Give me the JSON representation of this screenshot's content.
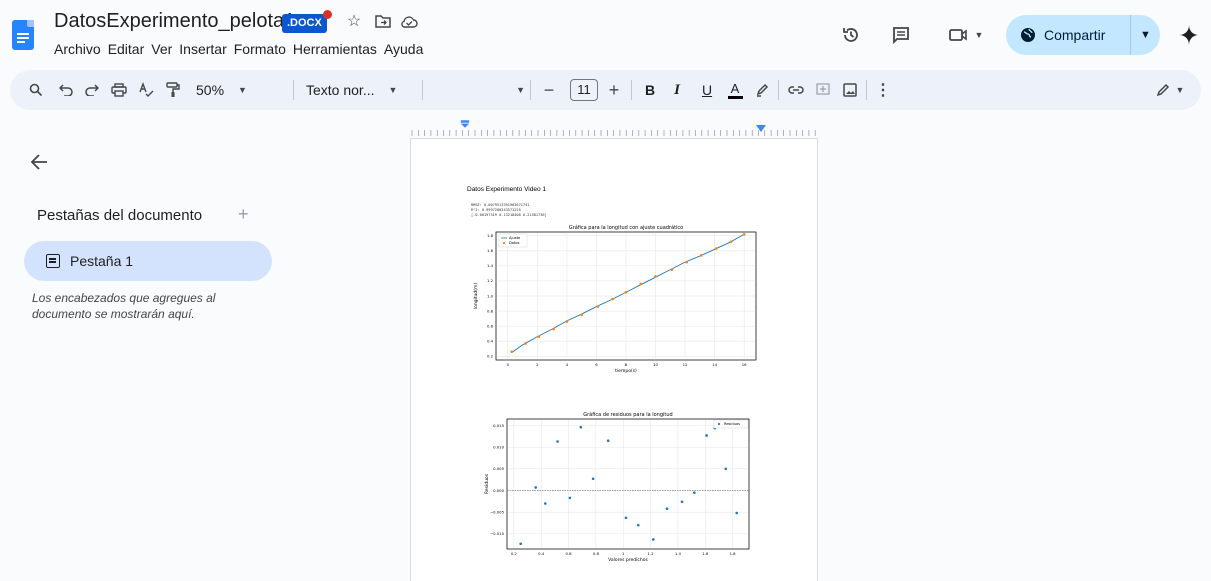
{
  "document": {
    "title": "DatosExperimento_pelota1",
    "format_badge": ".DOCX",
    "menu": [
      "Archivo",
      "Editar",
      "Ver",
      "Insertar",
      "Formato",
      "Herramientas",
      "Ayuda"
    ]
  },
  "header_actions": {
    "share_label": "Compartir"
  },
  "toolbar": {
    "zoom": "50%",
    "style": "Texto nor...",
    "font_size": "11",
    "bold": "B",
    "italic": "I",
    "underline": "U",
    "text_color": "A"
  },
  "sidebar": {
    "heading": "Pestañas del documento",
    "add": "+",
    "tabs": [
      {
        "label": "Pestaña 1"
      }
    ],
    "hint": "Los encabezados que agregues al documento se mostrarán aquí."
  },
  "page": {
    "title": "Datos Experimento Video 1",
    "stats": [
      "RMSE: 0.0079513391983671741",
      "R^2: 0.9997280343571225",
      "[-0.00197319  0.13218408  0.21581736]"
    ]
  },
  "colors": {
    "accent": "#0b57d0",
    "share_bg": "#c2e7ff",
    "active_tab": "#d3e3fd",
    "fit_line": "#1f77b4",
    "data_points": "#ff7f0e"
  },
  "chart_data": [
    {
      "type": "line",
      "title": "Gráfica para la longitud con ajuste cuadrático",
      "xlabel": "tiempo(s)",
      "ylabel": "longitud(m)",
      "xlim": [
        -0.8,
        16.8
      ],
      "ylim": [
        0.15,
        1.85
      ],
      "xticks": [
        0,
        2,
        4,
        6,
        8,
        10,
        12,
        14,
        16
      ],
      "yticks": [
        0.2,
        0.4,
        0.6,
        0.8,
        1.0,
        1.2,
        1.4,
        1.6,
        1.8
      ],
      "grid": true,
      "legend": "top-left",
      "series": [
        {
          "name": "Ajuste",
          "kind": "line",
          "x": [
            0.27,
            1,
            2,
            3,
            4,
            5,
            6,
            7,
            8,
            9,
            10,
            11,
            12,
            13,
            14,
            15,
            16
          ],
          "y": [
            0.25,
            0.35,
            0.46,
            0.56,
            0.67,
            0.76,
            0.86,
            0.95,
            1.05,
            1.15,
            1.25,
            1.35,
            1.45,
            1.53,
            1.62,
            1.71,
            1.82
          ]
        },
        {
          "name": "Datos",
          "kind": "scatter",
          "x": [
            0.27,
            1.2,
            2.1,
            3.1,
            4.0,
            5.0,
            6.1,
            7.1,
            8.0,
            9.0,
            10.0,
            11.1,
            12.1,
            13.1,
            14.1,
            15.1,
            16.0
          ],
          "y": [
            0.26,
            0.37,
            0.46,
            0.56,
            0.66,
            0.75,
            0.86,
            0.96,
            1.05,
            1.16,
            1.26,
            1.35,
            1.45,
            1.54,
            1.63,
            1.72,
            1.82
          ]
        }
      ]
    },
    {
      "type": "scatter",
      "title": "Gráfica de residuos para la longitud",
      "xlabel": "Valores predichos",
      "ylabel": "Residuos",
      "xlim": [
        0.15,
        1.92
      ],
      "ylim": [
        -0.0135,
        0.0165
      ],
      "xticks": [
        0.2,
        0.4,
        0.6,
        0.8,
        1.0,
        1.2,
        1.4,
        1.6,
        1.8
      ],
      "yticks": [
        -0.01,
        -0.005,
        0.0,
        0.005,
        0.01,
        0.015
      ],
      "ytick_labels": [
        "−0.010",
        "−0.005",
        "0.000",
        "0.005",
        "0.010",
        "0.015"
      ],
      "grid": true,
      "legend": "top-right",
      "series": [
        {
          "name": "Residuos",
          "x": [
            0.25,
            0.36,
            0.43,
            0.52,
            0.61,
            0.69,
            0.78,
            0.89,
            1.02,
            1.11,
            1.22,
            1.32,
            1.43,
            1.52,
            1.61,
            1.67,
            1.75,
            1.83
          ],
          "y": [
            -0.0123,
            0.0007,
            -0.003,
            0.0113,
            -0.0017,
            0.0146,
            0.0027,
            0.0115,
            -0.0063,
            -0.008,
            -0.0113,
            -0.0042,
            -0.0026,
            -0.0005,
            0.0127,
            0.0144,
            0.005,
            -0.0052
          ]
        }
      ]
    }
  ]
}
